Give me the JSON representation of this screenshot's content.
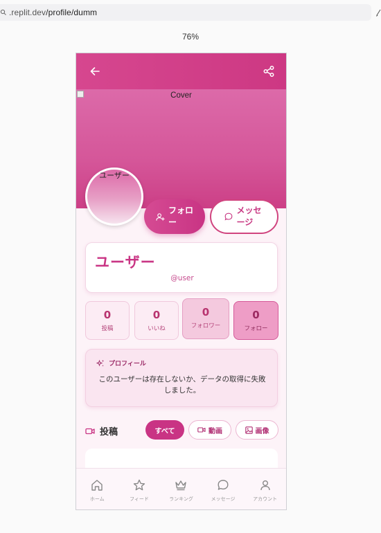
{
  "browser": {
    "url_prefix": ".replit.dev",
    "url_path": "/profile/dumm",
    "zoom": "76%"
  },
  "header": {
    "back_icon": "arrow-left-icon",
    "share_icon": "share-icon"
  },
  "cover": {
    "alt": "Cover"
  },
  "avatar": {
    "alt": "ユーザー"
  },
  "actions": {
    "follow_label": "フォロー",
    "message_label": "メッセージ"
  },
  "profile": {
    "name": "ユーザー",
    "handle": "@user"
  },
  "stats": [
    {
      "value": "0",
      "label": "投稿"
    },
    {
      "value": "0",
      "label": "いいね"
    },
    {
      "value": "0",
      "label": "フォロワー"
    },
    {
      "value": "0",
      "label": "フォロー"
    }
  ],
  "profile_card": {
    "title": "プロフィール",
    "message": "このユーザーは存在しないか、データの取得に失敗しました。"
  },
  "posts": {
    "title": "投稿",
    "tabs": [
      {
        "label": "すべて"
      },
      {
        "label": "動画"
      },
      {
        "label": "画像"
      }
    ]
  },
  "bottom_nav": [
    {
      "label": "ホーム",
      "icon": "home-icon"
    },
    {
      "label": "フィード",
      "icon": "star-icon"
    },
    {
      "label": "ランキング",
      "icon": "crown-icon"
    },
    {
      "label": "メッセージ",
      "icon": "chat-icon"
    },
    {
      "label": "アカウント",
      "icon": "user-icon"
    }
  ],
  "colors": {
    "accent": "#c93484",
    "cover": "#d55699",
    "background": "#fdf3f8"
  }
}
